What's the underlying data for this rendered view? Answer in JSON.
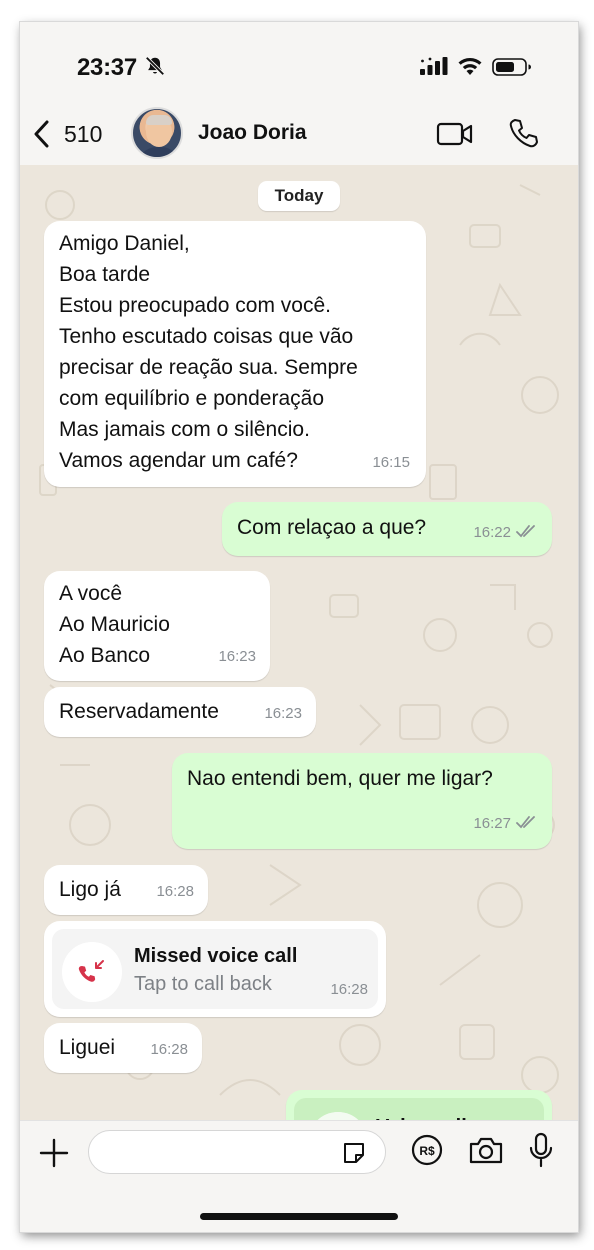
{
  "status_bar": {
    "time": "23:37",
    "icons": [
      "bell-slash-icon",
      "signal-icon",
      "wifi-icon",
      "battery-icon"
    ]
  },
  "header": {
    "back_count": "510",
    "contact_name": "Joao Doria",
    "icons": [
      "chevron-left-icon",
      "video-call-icon",
      "phone-icon"
    ]
  },
  "chat": {
    "date_divider": "Today",
    "messages": [
      {
        "direction": "in",
        "text": "Amigo Daniel,\nBoa tarde\nEstou preocupado com você.\nTenho escutado coisas que vão\nprecisar de reação sua. Sempre\ncom equilíbrio e ponderação\nMas jamais com o silêncio.\nVamos agendar um café?",
        "time": "16:15"
      },
      {
        "direction": "out",
        "text": "Com relaçao a que?",
        "time": "16:22",
        "status": "read"
      },
      {
        "direction": "in",
        "text": "A você\nAo Mauricio\nAo Banco",
        "time": "16:23"
      },
      {
        "direction": "in",
        "text": "Reservadamente",
        "time": "16:23"
      },
      {
        "direction": "out",
        "text": "Nao entendi bem, quer me ligar?",
        "time": "16:27",
        "status": "read"
      },
      {
        "direction": "in",
        "text": "Ligo já",
        "time": "16:28"
      },
      {
        "direction": "in",
        "type": "missed_call",
        "title": "Missed voice call",
        "subtitle": "Tap to call back",
        "time": "16:28"
      },
      {
        "direction": "in",
        "text": "Liguei",
        "time": "16:28"
      },
      {
        "direction": "out",
        "type": "voice_call",
        "title": "Voice call"
      }
    ]
  },
  "input_bar": {
    "placeholder": "",
    "icons": [
      "plus-icon",
      "sticker-icon",
      "pix-icon",
      "camera-icon",
      "microphone-icon"
    ]
  },
  "colors": {
    "outgoing_bubble": "#d9fdd3",
    "incoming_bubble": "#ffffff",
    "chat_background": "#ece6dc",
    "read_ticks": "#8a8f94",
    "missed_call_red": "#d6334a"
  }
}
